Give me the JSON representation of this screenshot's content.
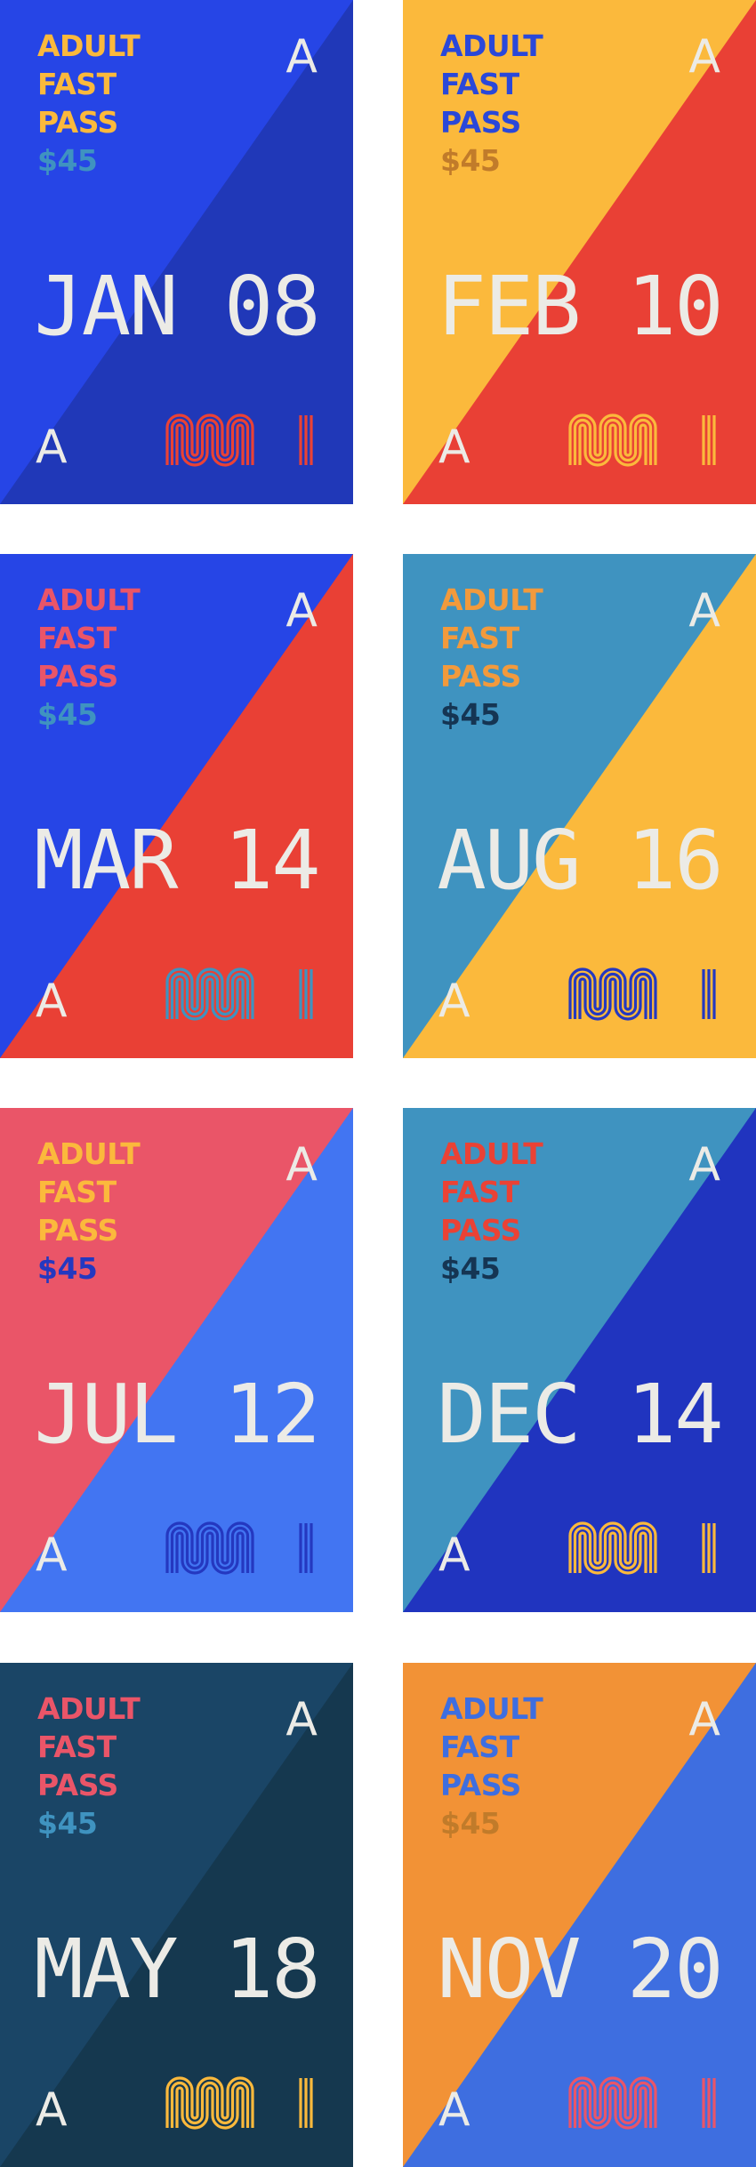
{
  "passes": [
    {
      "label": [
        "ADULT",
        "FAST",
        "PASS"
      ],
      "price": "$45",
      "zone": "A",
      "date": "JAN 08",
      "logo_text": "muni",
      "bg_a": "#2645e6",
      "bg_b": "#2038b8",
      "label_color": "#fbb93c",
      "price_color": "#3f93c0",
      "logo_color": "#ea4235"
    },
    {
      "label": [
        "ADULT",
        "FAST",
        "PASS"
      ],
      "price": "$45",
      "zone": "A",
      "date": "FEB 10",
      "logo_text": "muni",
      "bg_a": "#fbb93c",
      "bg_b": "#e94035",
      "label_color": "#2a48d9",
      "price_color": "#c17b2a",
      "logo_color": "#fbb93c"
    },
    {
      "label": [
        "ADULT",
        "FAST",
        "PASS"
      ],
      "price": "$45",
      "zone": "A",
      "date": "MAR 14",
      "logo_text": "muni",
      "bg_a": "#2645e6",
      "bg_b": "#e94035",
      "label_color": "#ea5568",
      "price_color": "#3f93c0",
      "logo_color": "#3f93c0"
    },
    {
      "label": [
        "ADULT",
        "FAST",
        "PASS"
      ],
      "price": "$45",
      "zone": "A",
      "date": "AUG 16",
      "logo_text": "muni",
      "bg_a": "#3f93c0",
      "bg_b": "#fbb93c",
      "label_color": "#f29a3c",
      "price_color": "#153553",
      "logo_color": "#2438c0"
    },
    {
      "label": [
        "ADULT",
        "FAST",
        "PASS"
      ],
      "price": "$45",
      "zone": "A",
      "date": "JUL 12",
      "logo_text": "muni",
      "bg_a": "#ea5568",
      "bg_b": "#4275f2",
      "label_color": "#fbb93c",
      "price_color": "#2438c0",
      "logo_color": "#2438c0"
    },
    {
      "label": [
        "ADULT",
        "FAST",
        "PASS"
      ],
      "price": "$45",
      "zone": "A",
      "date": "DEC 14",
      "logo_text": "muni",
      "bg_a": "#3f93c0",
      "bg_b": "#2034bf",
      "label_color": "#ea4235",
      "price_color": "#153553",
      "logo_color": "#fbb93c"
    },
    {
      "label": [
        "ADULT",
        "FAST",
        "PASS"
      ],
      "price": "$45",
      "zone": "A",
      "date": "MAY 18",
      "logo_text": "muni",
      "bg_a": "#1a4566",
      "bg_b": "#15384f",
      "label_color": "#ea5568",
      "price_color": "#3f93c0",
      "logo_color": "#fbb93c"
    },
    {
      "label": [
        "ADULT",
        "FAST",
        "PASS"
      ],
      "price": "$45",
      "zone": "A",
      "date": "NOV 20",
      "logo_text": "muni",
      "bg_a": "#f29236",
      "bg_b": "#3e6ee0",
      "label_color": "#3e6ee0",
      "price_color": "#c17b2a",
      "logo_color": "#ea5568"
    }
  ]
}
